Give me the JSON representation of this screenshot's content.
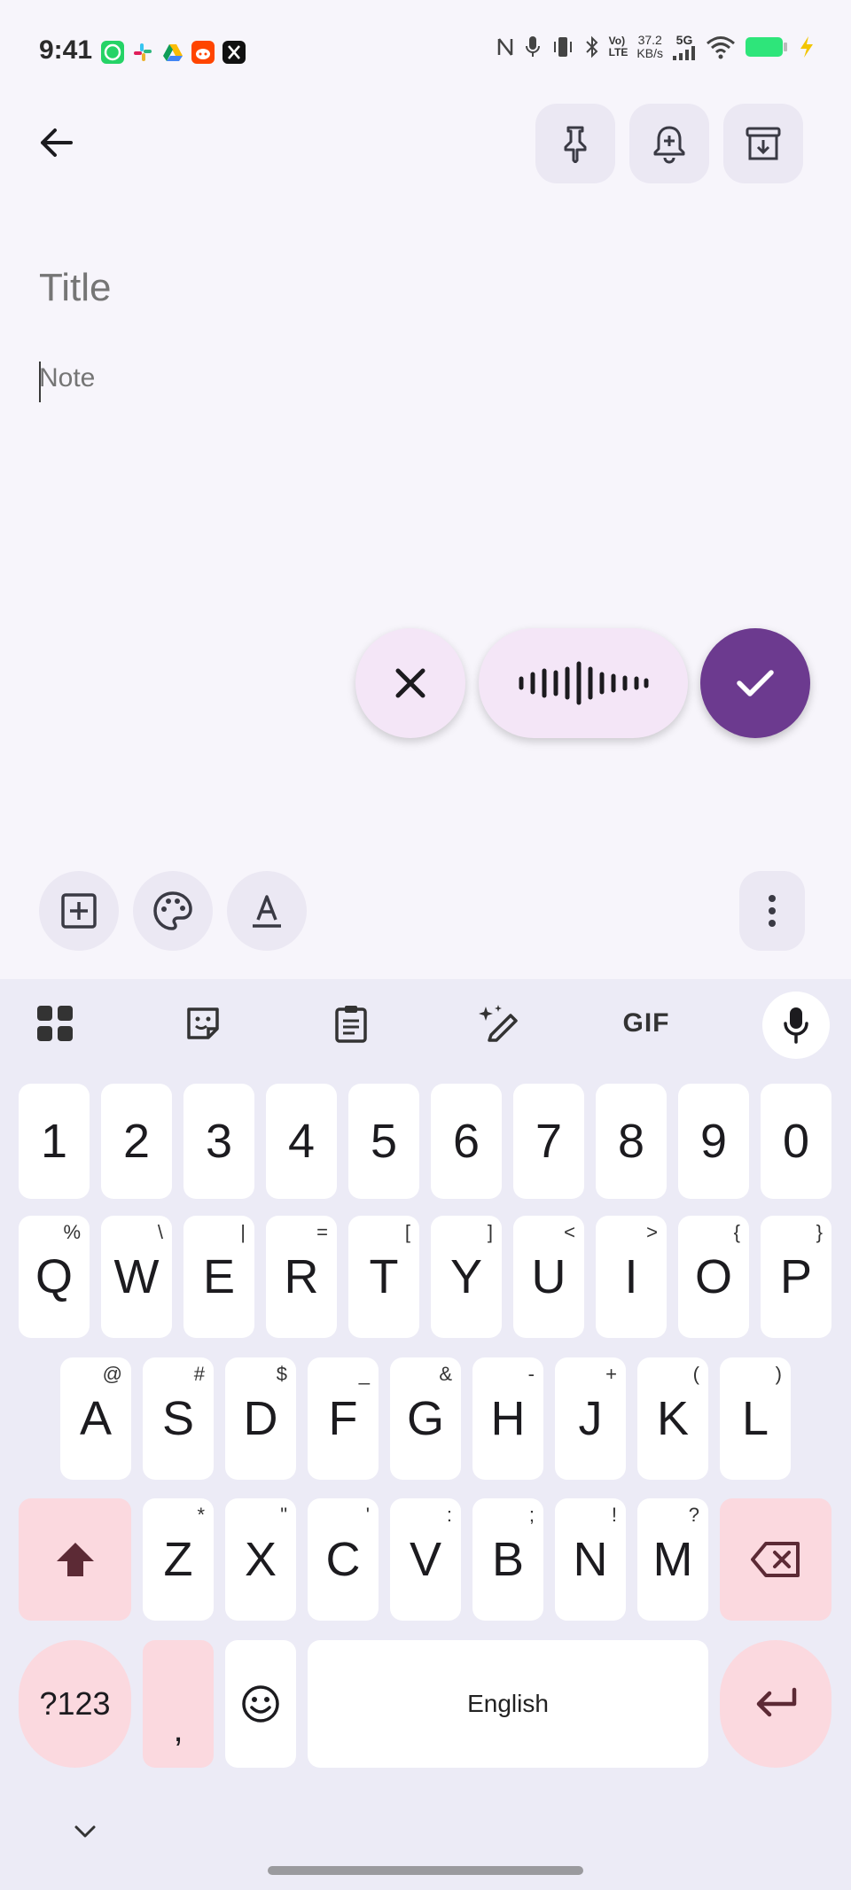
{
  "status_bar": {
    "time": "9:41",
    "lte_top": "Vo)",
    "lte_bottom": "LTE",
    "speed_value": "37.2",
    "speed_unit": "KB/s",
    "network": "5G",
    "apps": [
      "whatsapp-icon",
      "slack-icon",
      "drive-icon",
      "reddit-icon",
      "x-icon"
    ],
    "battery_color": "#2ee57a"
  },
  "note": {
    "title_placeholder": "Title",
    "body_placeholder": "Note"
  },
  "keyboard": {
    "number_row": [
      "1",
      "2",
      "3",
      "4",
      "5",
      "6",
      "7",
      "8",
      "9",
      "0"
    ],
    "row1": [
      {
        "key": "Q",
        "hint": "%"
      },
      {
        "key": "W",
        "hint": "\\"
      },
      {
        "key": "E",
        "hint": "|"
      },
      {
        "key": "R",
        "hint": "="
      },
      {
        "key": "T",
        "hint": "["
      },
      {
        "key": "Y",
        "hint": "]"
      },
      {
        "key": "U",
        "hint": "<"
      },
      {
        "key": "I",
        "hint": ">"
      },
      {
        "key": "O",
        "hint": "{"
      },
      {
        "key": "P",
        "hint": "}"
      }
    ],
    "row2": [
      {
        "key": "A",
        "hint": "@"
      },
      {
        "key": "S",
        "hint": "#"
      },
      {
        "key": "D",
        "hint": "$"
      },
      {
        "key": "F",
        "hint": "_"
      },
      {
        "key": "G",
        "hint": "&"
      },
      {
        "key": "H",
        "hint": "-"
      },
      {
        "key": "J",
        "hint": "+"
      },
      {
        "key": "K",
        "hint": "("
      },
      {
        "key": "L",
        "hint": ")"
      }
    ],
    "row3": [
      {
        "key": "Z",
        "hint": "*"
      },
      {
        "key": "X",
        "hint": "\""
      },
      {
        "key": "C",
        "hint": "'"
      },
      {
        "key": "V",
        "hint": ":"
      },
      {
        "key": "B",
        "hint": ";"
      },
      {
        "key": "N",
        "hint": "!"
      },
      {
        "key": "M",
        "hint": "?"
      }
    ],
    "symbols_label": "?123",
    "comma_label": ",",
    "space_label": "English",
    "gif_label": "GIF"
  },
  "colors": {
    "accent": "#6c3a8f",
    "special_key": "#fbd9df",
    "background": "#f7f5fb"
  }
}
